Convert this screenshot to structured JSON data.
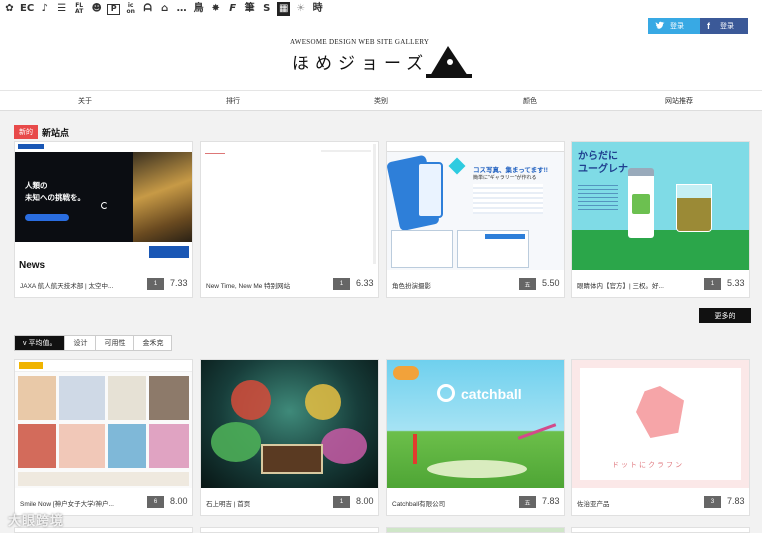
{
  "category_bar": {
    "items": [
      {
        "label": "✿",
        "icon": "flower-icon"
      },
      {
        "label": "EC",
        "icon": "ec-label"
      },
      {
        "label": "♪",
        "icon": "music-note-icon"
      },
      {
        "label": "☰",
        "icon": "line-icon"
      },
      {
        "label": "FL AT",
        "icon": "flat-label"
      },
      {
        "label": "☻",
        "icon": "face-icon"
      },
      {
        "label": "P",
        "icon": "p-icon"
      },
      {
        "label": "ic on",
        "icon": "icon-label"
      },
      {
        "label": "ᗩ",
        "icon": "a-shape-icon"
      },
      {
        "label": "⌂",
        "icon": "house-icon"
      },
      {
        "label": "…",
        "icon": "dots-icon"
      },
      {
        "label": "鳥",
        "icon": "bird-kanji-icon"
      },
      {
        "label": "✸",
        "icon": "starburst-icon"
      },
      {
        "label": "F",
        "icon": "f-icon"
      },
      {
        "label": "筆",
        "icon": "brush-kanji-icon"
      },
      {
        "label": "S",
        "icon": "s-icon"
      },
      {
        "label": "▦",
        "icon": "grid-icon"
      },
      {
        "label": "☀",
        "icon": "sun-icon"
      },
      {
        "label": "時",
        "icon": "time-kanji-icon"
      }
    ]
  },
  "header": {
    "tagline": "AWESOME DESIGN WEB SITE GALLERY",
    "logo_text": "ほめジョーズ",
    "twitter_login": "登录",
    "facebook_login": "登录"
  },
  "nav": {
    "items": [
      "关于",
      "排行",
      "类别",
      "颜色",
      "网站推荐"
    ]
  },
  "new_sites": {
    "badge": "新的",
    "title": "新站点",
    "cards": [
      {
        "name": "JAXA 航人航天技术部 | 太空中...",
        "count": "1",
        "score": "7.33"
      },
      {
        "name": "New Time, New Me 特别网站",
        "count": "1",
        "score": "6.33"
      },
      {
        "name": "角色扮演摄影",
        "count": "五",
        "score": "5.50"
      },
      {
        "name": "眼睛体内【官方】| 三权。好...",
        "count": "1",
        "score": "5.33"
      }
    ],
    "more": "更多的"
  },
  "ranked": {
    "tabs": [
      "v 平均值。",
      "设计",
      "可用性",
      "金禾克"
    ],
    "cards": [
      {
        "name": "Smile Now [神户女子大学/神户...",
        "count": "6",
        "score": "8.00"
      },
      {
        "name": "石上明吉 | 首页",
        "count": "1",
        "score": "8.00"
      },
      {
        "name": "Catchball有限公司",
        "count": "五",
        "score": "7.83"
      },
      {
        "name": "佐治亚产品",
        "count": "3",
        "score": "7.83"
      }
    ]
  },
  "screenshots": {
    "jaxa_headline_1": "人類の",
    "jaxa_headline_2": "未知への挑戦を。",
    "jaxa_news": "News",
    "cos_line1": "コス写真、集まってます!!",
    "cos_line2": "簡単に\"ギャラリー\"が作れる",
    "euglena_1": "からだに",
    "euglena_2": "ユーグレナ",
    "catchball_logo": "catchball",
    "georgia_text": "ドットにクラフン"
  },
  "watermark": "大眼跨境",
  "colors": {
    "new_badge": "#e84a4a",
    "twitter": "#38a9e4",
    "facebook": "#3b5998"
  }
}
